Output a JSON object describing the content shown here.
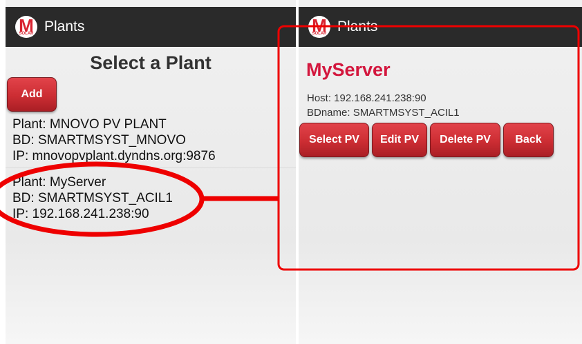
{
  "left_screen": {
    "actionbar": {
      "logo_letter": "M",
      "logo_sub": "SOLAR",
      "title": "Plants"
    },
    "heading": "Select a Plant",
    "add_label": "Add",
    "plants": [
      {
        "plant": "Plant: MNOVO PV PLANT",
        "bd": "BD: SMARTMSYST_MNOVO",
        "ip": "IP: mnovopvplant.dyndns.org:9876"
      },
      {
        "plant": "Plant: MyServer",
        "bd": "BD: SMARTMSYST_ACIL1",
        "ip": "IP: 192.168.241.238:90"
      }
    ]
  },
  "right_screen": {
    "actionbar": {
      "logo_letter": "M",
      "logo_sub": "SOLAR",
      "title": "Plants"
    },
    "server_name": "MyServer",
    "host": "Host: 192.168.241.238:90",
    "bdname": "BDname: SMARTMSYST_ACIL1",
    "buttons": {
      "select": "Select PV",
      "edit": "Edit PV",
      "delete": "Delete PV",
      "back": "Back"
    }
  },
  "colors": {
    "accent_red": "#d3163d",
    "button_red": "#cc2d33",
    "actionbar": "#2a2a2a",
    "annotation_red": "#ee0000"
  }
}
